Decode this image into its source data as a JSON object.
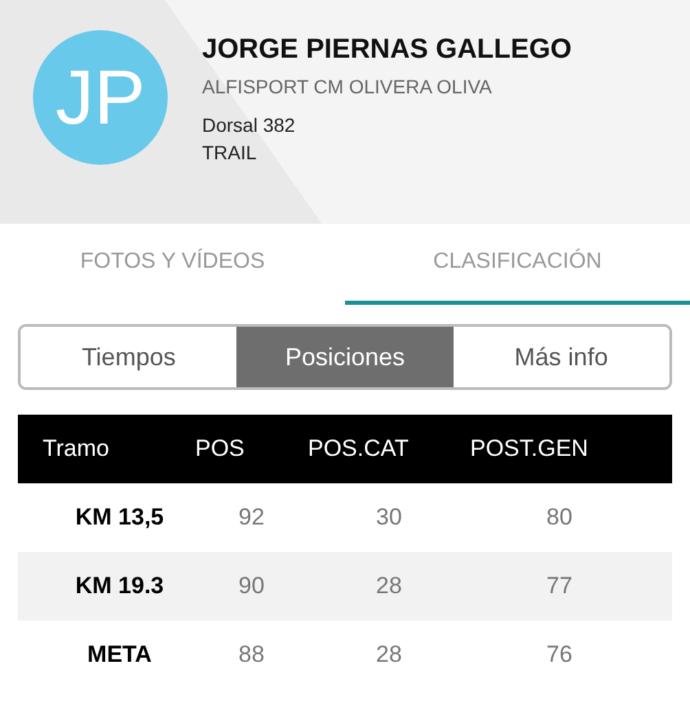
{
  "profile": {
    "initials": "JP",
    "name": "JORGE PIERNAS GALLEGO",
    "club": "ALFISPORT CM OLIVERA OLIVA",
    "bib": "Dorsal 382",
    "category": "TRAIL"
  },
  "tabs": [
    {
      "label": "FOTOS Y VÍDEOS",
      "selected": false
    },
    {
      "label": "CLASIFICACIÓN",
      "selected": true
    }
  ],
  "segments": [
    {
      "label": "Tiempos",
      "selected": false
    },
    {
      "label": "Posiciones",
      "selected": true
    },
    {
      "label": "Más info",
      "selected": false
    }
  ],
  "table": {
    "columns": [
      "Tramo",
      "POS",
      "POS.CAT",
      "POST.GEN"
    ],
    "rows": [
      [
        "KM 13,5",
        "92",
        "30",
        "80"
      ],
      [
        "KM 19.3",
        "90",
        "28",
        "77"
      ],
      [
        "META",
        "88",
        "28",
        "76"
      ]
    ]
  }
}
